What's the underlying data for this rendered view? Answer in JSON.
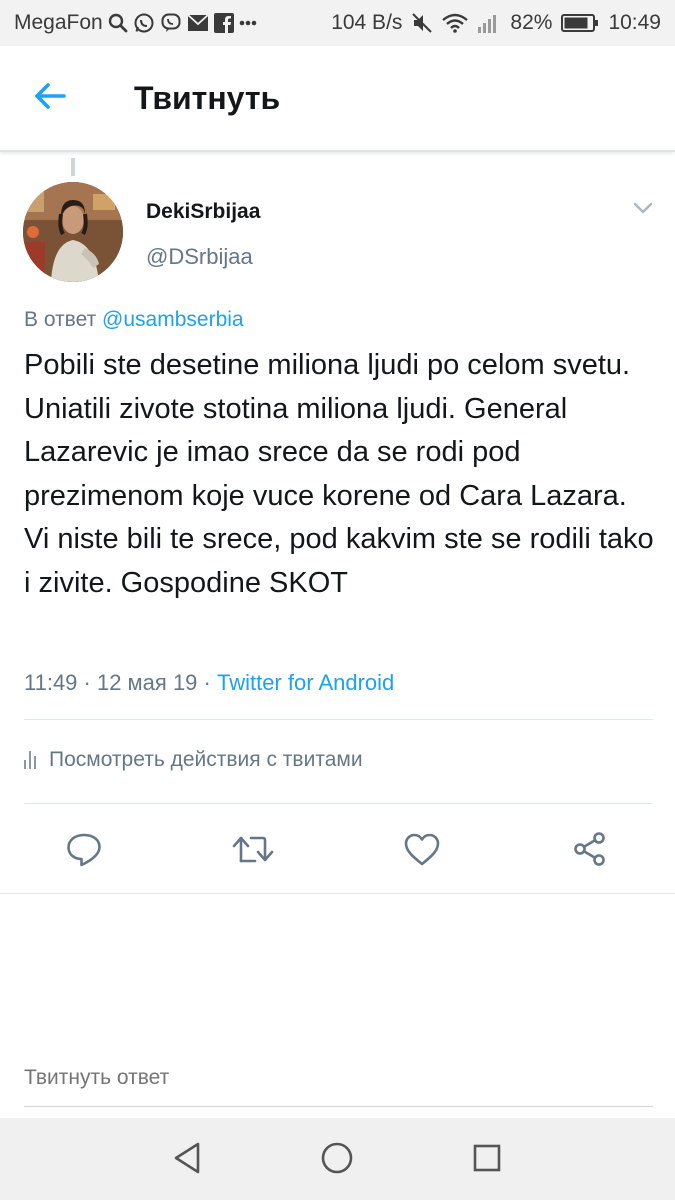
{
  "status_bar": {
    "carrier": "MegaFon",
    "net_speed": "104 B/s",
    "battery": "82%",
    "time": "10:49",
    "left_icons": [
      "search-icon",
      "whatsapp-icon",
      "viber-icon",
      "mail-icon",
      "facebook-icon",
      "more-dots-icon"
    ],
    "right_icons": [
      "mute-icon",
      "wifi-icon",
      "signal-icon",
      "battery-icon"
    ]
  },
  "header": {
    "title": "Твитнуть",
    "back_icon": "arrow-left-icon",
    "accent_color": "#1da1f2"
  },
  "tweet": {
    "author_name": "DekiSrbijaa",
    "author_handle": "@DSrbijaa",
    "reply_prefix": "В ответ",
    "reply_to": "@usambserbia",
    "text": "Pobili ste desetine miliona ljudi po celom svetu. Uniatili zivote stotina miliona ljudi. General Lazarevic je imao srece da se rodi pod prezimenom koje vuce korene od Cara Lazara. Vi niste bili te srece, pod kakvim ste se rodili tako i zivite. Gospodine SKOT",
    "timestamp": "11:49 · 12 мая 19 · ",
    "source": "Twitter for Android",
    "activity_label": "Посмотреть действия с твитами"
  },
  "actions": [
    "reply-icon",
    "retweet-icon",
    "like-icon",
    "share-icon"
  ],
  "reply_box": {
    "placeholder": "Твитнуть ответ"
  },
  "nav_bar": [
    "back-triangle-icon",
    "home-circle-icon",
    "recents-square-icon"
  ]
}
